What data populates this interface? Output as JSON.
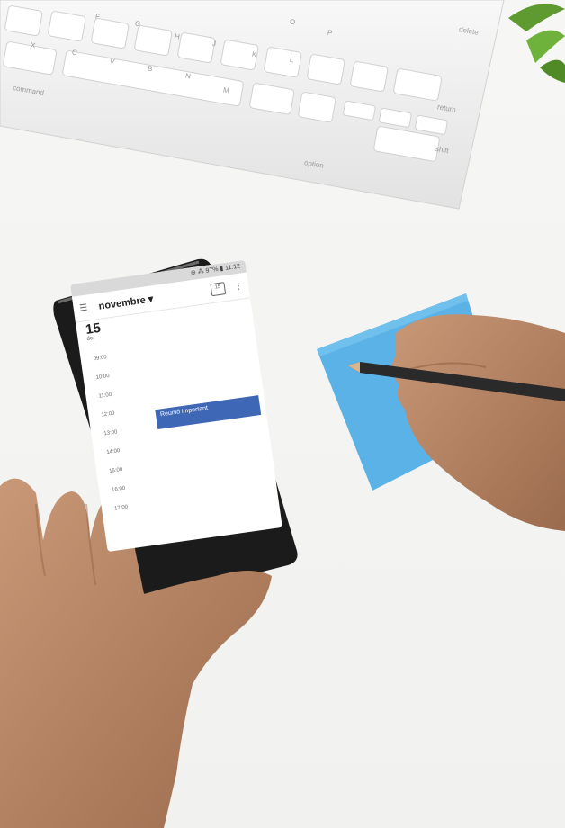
{
  "keyboard": {
    "keys": [
      "command",
      "option",
      "return",
      "shift",
      "delete",
      "X",
      "C",
      "V",
      "B",
      "N",
      "M",
      "K",
      "L",
      "O",
      "P",
      "F",
      "G",
      "H",
      "J"
    ]
  },
  "phone": {
    "status": "⊕ ⁂ 97% ▮ 11:12",
    "month": "novembre",
    "month_arrow": "▾",
    "calendar_icon_day": "15",
    "day_number": "15",
    "day_name": "dc.",
    "times": [
      "09:00",
      "10:00",
      "11:00",
      "12:00",
      "13:00",
      "14:00",
      "15:00",
      "16:00",
      "17:00"
    ],
    "event_title": "Reunió important",
    "fab_symbol": "+"
  }
}
